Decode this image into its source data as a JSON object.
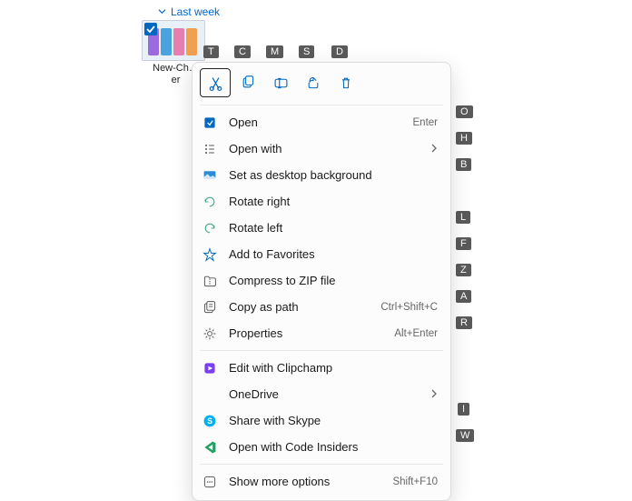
{
  "group": {
    "label": "Last week"
  },
  "file": {
    "name_truncated": "New-Ch…\ner"
  },
  "quick_actions": {
    "cut": "cut",
    "copy": "copy",
    "rename": "rename",
    "share": "share",
    "delete": "delete"
  },
  "key_tips_top": {
    "t": "T",
    "c": "C",
    "m": "M",
    "s": "S",
    "d": "D"
  },
  "key_tips_side": {
    "o": "O",
    "h": "H",
    "b": "B",
    "l": "L",
    "f": "F",
    "z": "Z",
    "a": "A",
    "r": "R",
    "i": "I",
    "w": "W"
  },
  "menu": {
    "group1": [
      {
        "icon": "open",
        "label": "Open",
        "shortcut": "Enter"
      },
      {
        "icon": "openwith",
        "label": "Open with",
        "submenu": true
      },
      {
        "icon": "desktop",
        "label": "Set as desktop background"
      },
      {
        "icon": "rotright",
        "label": "Rotate right"
      },
      {
        "icon": "rotleft",
        "label": "Rotate left"
      },
      {
        "icon": "star",
        "label": "Add to Favorites"
      },
      {
        "icon": "zip",
        "label": "Compress to ZIP file"
      },
      {
        "icon": "copypath",
        "label": "Copy as path",
        "shortcut": "Ctrl+Shift+C"
      },
      {
        "icon": "props",
        "label": "Properties",
        "shortcut": "Alt+Enter"
      }
    ],
    "group2": [
      {
        "icon": "clipchamp",
        "label": "Edit with Clipchamp"
      },
      {
        "icon": "onedrive",
        "label": "OneDrive",
        "submenu": true
      },
      {
        "icon": "skype",
        "label": "Share with Skype"
      },
      {
        "icon": "vscode",
        "label": "Open with Code Insiders"
      }
    ],
    "group3": [
      {
        "icon": "more",
        "label": "Show more options",
        "shortcut": "Shift+F10"
      }
    ]
  }
}
